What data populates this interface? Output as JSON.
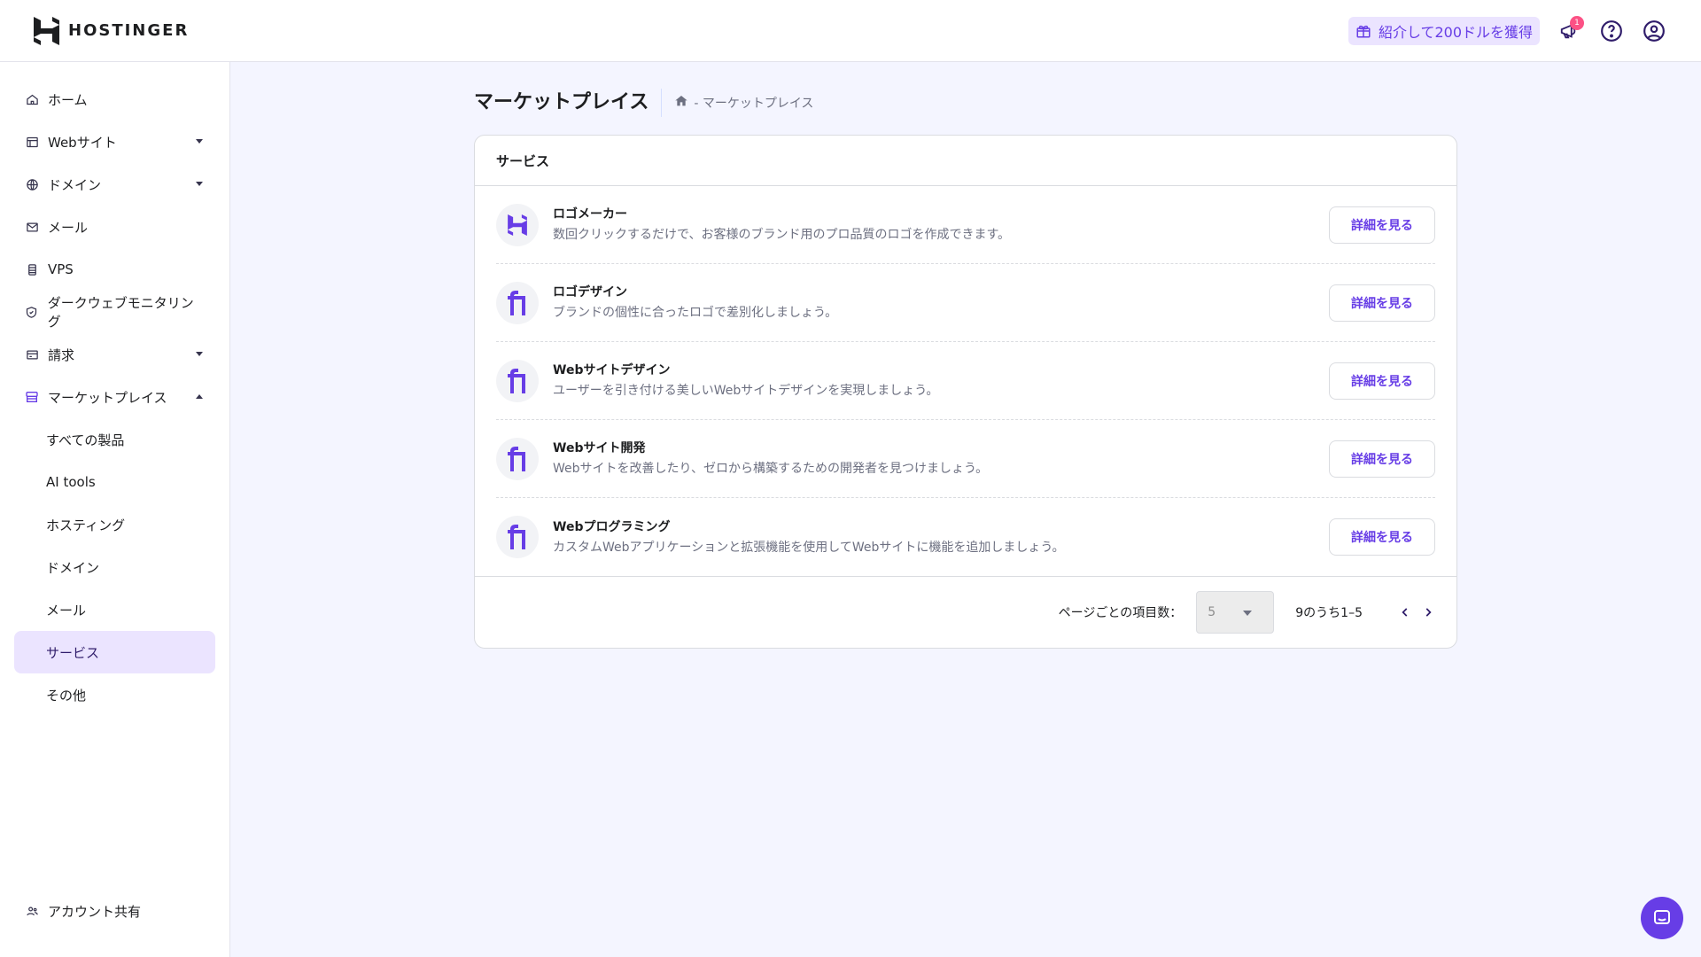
{
  "app": {
    "brand": "HOSTINGER",
    "colors": {
      "accent": "#673de6",
      "accent_light": "#ebe4ff",
      "text": "#1d1e20",
      "muted": "#6d7081",
      "badge": "#fc5185"
    }
  },
  "topbar": {
    "referral_label": "紹介して200ドルを獲得",
    "notification_count": "1",
    "icons": [
      "gift-icon",
      "megaphone-icon",
      "help-icon",
      "account-icon"
    ]
  },
  "sidebar": {
    "items": [
      {
        "label": "ホーム",
        "icon": "home-icon"
      },
      {
        "label": "Webサイト",
        "icon": "website-icon"
      },
      {
        "label": "ドメイン",
        "icon": "globe-icon"
      },
      {
        "label": "メール",
        "icon": "mail-icon"
      },
      {
        "label": "VPS",
        "icon": "server-icon"
      },
      {
        "label": "ダークウェブモニタリング",
        "icon": "shield-icon"
      },
      {
        "label": "請求",
        "icon": "billing-icon"
      },
      {
        "label": "マーケットプレイス",
        "icon": "marketplace-icon"
      }
    ],
    "sub_items": [
      {
        "label": "すべての製品"
      },
      {
        "label": "AI tools"
      },
      {
        "label": "ホスティング"
      },
      {
        "label": "ドメイン"
      },
      {
        "label": "メール"
      },
      {
        "label": "サービス"
      },
      {
        "label": "その他"
      }
    ],
    "bottom_item": {
      "label": "アカウント共有",
      "icon": "users-icon"
    }
  },
  "main": {
    "page_title": "マーケットプレイス",
    "breadcrumb_text": "- マーケットプレイス",
    "card_title": "サービス",
    "button_label": "詳細を見る",
    "services": [
      {
        "title": "ロゴメーカー",
        "desc": "数回クリックするだけで、お客様のブランド用のプロ品質のロゴを作成できます。",
        "icon": "hostinger-logo-icon"
      },
      {
        "title": "ロゴデザイン",
        "desc": "ブランドの個性に合ったロゴで差別化しましょう。",
        "icon": "fiverr-icon"
      },
      {
        "title": "Webサイトデザイン",
        "desc": "ユーザーを引き付ける美しいWebサイトデザインを実現しましょう。",
        "icon": "fiverr-icon"
      },
      {
        "title": "Webサイト開発",
        "desc": "Webサイトを改善したり、ゼロから構築するための開発者を見つけましょう。",
        "icon": "fiverr-icon"
      },
      {
        "title": "Webプログラミング",
        "desc": "カスタムWebアプリケーションと拡張機能を使用してWebサイトに機能を追加しましょう。",
        "icon": "fiverr-icon"
      }
    ],
    "pagination": {
      "per_page_label": "ページごとの項目数：",
      "per_page_value": "5",
      "range_text": "9のうち1–5"
    }
  }
}
